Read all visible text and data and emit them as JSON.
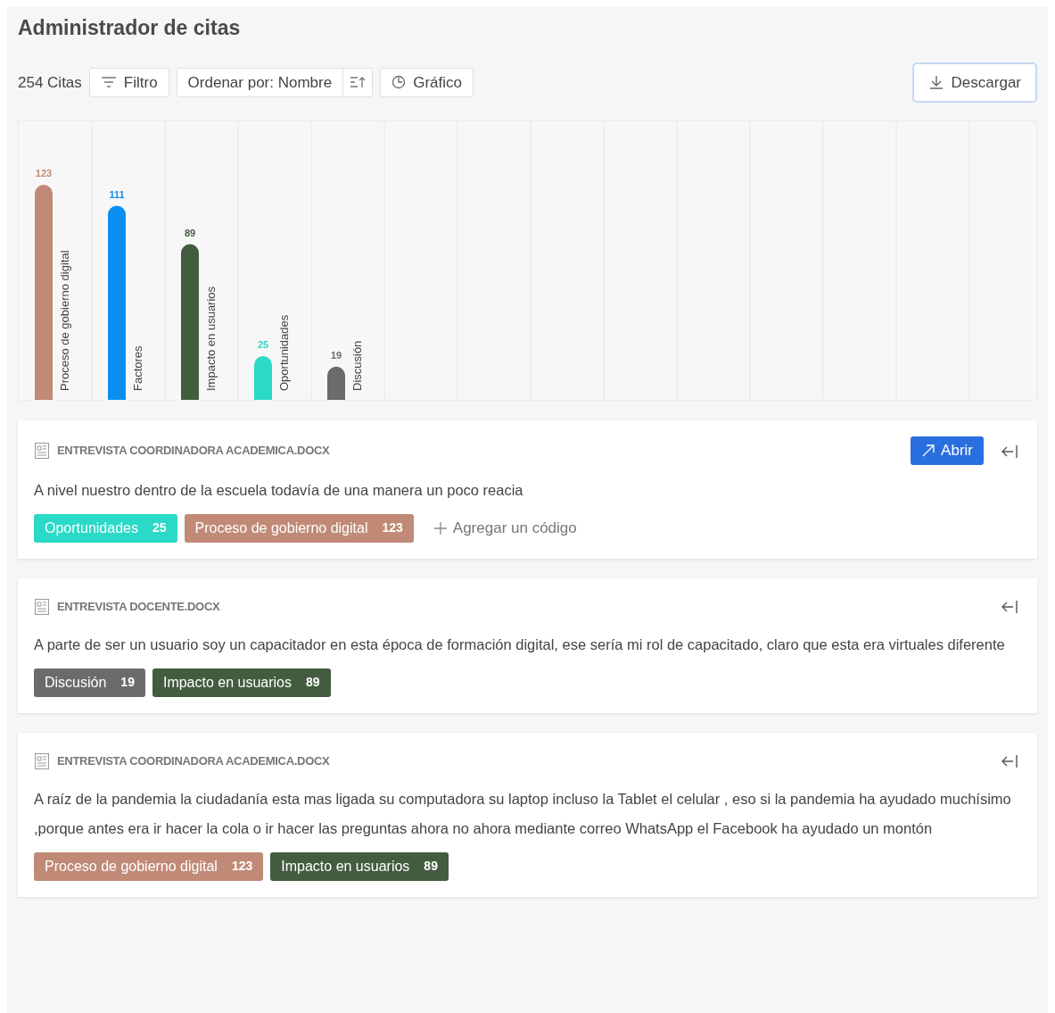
{
  "title": "Administrador de citas",
  "toolbar": {
    "count": "254 Citas",
    "filter": "Filtro",
    "sort": "Ordenar por: Nombre",
    "chart_button": "Gráfico",
    "download": "Descargar"
  },
  "chart": {
    "chart_data": {
      "type": "bar",
      "categories": [
        "Proceso de gobierno digital",
        "Factores",
        "Impacto en usuarios",
        "Oportunidades",
        "Discusión"
      ],
      "values": [
        123,
        111,
        89,
        25,
        19
      ],
      "colors": [
        "#c08a77",
        "#0a8ff0",
        "#435c3f",
        "#2ad9c6",
        "#6b6b6b"
      ],
      "data_labels": true
    }
  },
  "quotes": [
    {
      "document": "ENTREVISTA COORDINADORA ACADEMICA.DOCX",
      "open_button": "Abrir",
      "text": "A nivel nuestro dentro de la escuela todavía de una manera un poco reacia",
      "codes": [
        {
          "name": "Oportunidades",
          "count": "25",
          "color": "#2ad9c6"
        },
        {
          "name": "Proceso de gobierno digital",
          "count": "123",
          "color": "#c08a77"
        }
      ],
      "add_code": "Agregar un código"
    },
    {
      "document": "ENTREVISTA DOCENTE.DOCX",
      "text": "A parte de ser un usuario soy un capacitador en esta época de formación digital, ese sería mi rol de capacitado, claro que esta era virtuales diferente",
      "codes": [
        {
          "name": "Discusión",
          "count": "19",
          "color": "#6b6b6b"
        },
        {
          "name": "Impacto en usuarios",
          "count": "89",
          "color": "#435c3f"
        }
      ]
    },
    {
      "document": "ENTREVISTA COORDINADORA ACADEMICA.DOCX",
      "text": "A raíz de la pandemia la ciudadanía esta mas ligada su computadora su laptop incluso la Tablet el celular , eso si la pandemia ha ayudado muchísimo ,porque antes era ir hacer la cola o ir hacer las preguntas ahora no ahora mediante correo WhatsApp el Facebook ha ayudado un montón",
      "codes": [
        {
          "name": "Proceso de gobierno digital",
          "count": "123",
          "color": "#c08a77"
        },
        {
          "name": "Impacto en usuarios",
          "count": "89",
          "color": "#435c3f"
        }
      ]
    }
  ]
}
